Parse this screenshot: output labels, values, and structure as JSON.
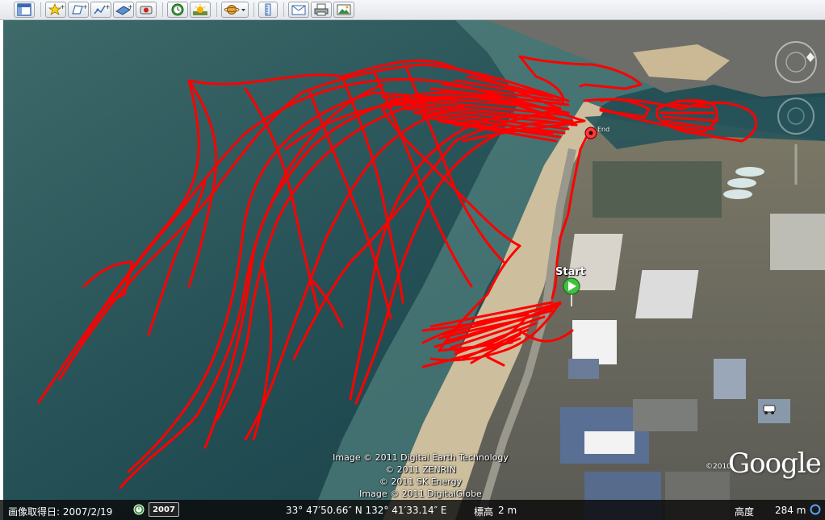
{
  "toolbar": {
    "icons": [
      "sidebar-icon",
      "placemark-icon",
      "polygon-icon",
      "path-icon",
      "image-overlay-icon",
      "record-tour-icon",
      "historical-imagery-icon",
      "sun-icon",
      "planets-icon",
      "ruler-icon",
      "email-icon",
      "print-icon",
      "save-image-icon"
    ]
  },
  "map": {
    "credits": [
      "Image © 2011 Digital Earth Technology",
      "© 2011 ZENRIN",
      "© 2011 SK Energy",
      "Image © 2011 DigitalGlobe"
    ],
    "logo": "Google",
    "logo_year": "©2010",
    "start_label": "Start",
    "end_label": "End",
    "track_color": "#ff0000",
    "start_marker_color": "#3fc23f"
  },
  "status": {
    "imagery_date": "画像取得日: 2007/2/19",
    "imagery_year": "2007",
    "coordinates": "33° 47′50.66″ N 132° 41′33.14″ E",
    "elevation_label": "標高",
    "elevation_value": "2 m",
    "eye_alt_label": "高度",
    "eye_alt_value": "284 m"
  }
}
